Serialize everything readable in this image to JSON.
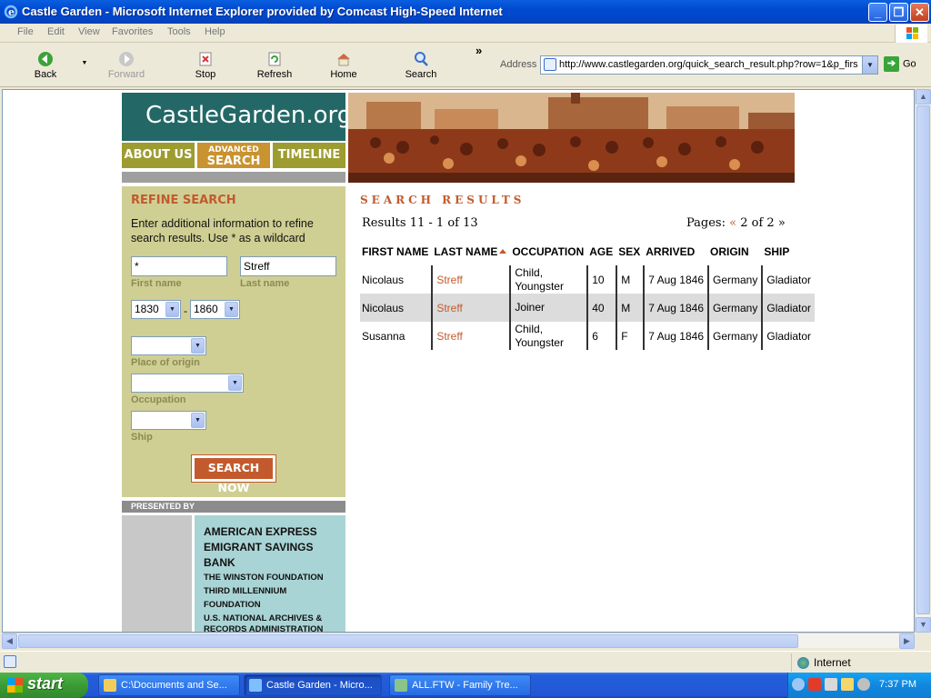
{
  "window": {
    "title": "Castle Garden - Microsoft Internet Explorer provided by Comcast High-Speed Internet"
  },
  "menu": [
    "File",
    "Edit",
    "View",
    "Favorites",
    "Tools",
    "Help"
  ],
  "toolbar": {
    "back": "Back",
    "forward": "Forward",
    "stop": "Stop",
    "refresh": "Refresh",
    "home": "Home",
    "search": "Search",
    "more": "»",
    "address_label": "Address",
    "url": "http://www.castlegarden.org/quick_search_result.php?row=1&p_firs",
    "go": "Go"
  },
  "site": {
    "logo": "CastleGarden.org",
    "nav": {
      "about": "ABOUT US",
      "advanced_top": "ADVANCED",
      "advanced_bottom": "SEARCH",
      "timeline": "TIMELINE"
    }
  },
  "refine": {
    "heading": "REFINE SEARCH",
    "description": "Enter additional information to refine search results. Use * as a wildcard",
    "first_name_value": "*",
    "first_name_label": "First name",
    "last_name_value": "Streff",
    "last_name_label": "Last name",
    "year_from": "1830",
    "year_to": "1860",
    "dash": "-",
    "origin_label": "Place of origin",
    "occupation_label": "Occupation",
    "ship_label": "Ship",
    "search_button": "SEARCH NOW"
  },
  "sponsors": {
    "heading": "PRESENTED BY",
    "items": [
      "AMERICAN EXPRESS",
      "EMIGRANT SAVINGS BANK",
      "THE WINSTON FOUNDATION",
      "THIRD MILLENNIUM FOUNDATION",
      "U.S. NATIONAL ARCHIVES & RECORDS ADMINISTRATION"
    ]
  },
  "results": {
    "title": "SEARCH RESULTS",
    "count": "Results 11 - 1 of 13",
    "pages_label": "Pages:",
    "prev": "«",
    "page_info": "2 of 2",
    "next": "»",
    "columns": [
      "FIRST NAME",
      "LAST NAME",
      "OCCUPATION",
      "AGE",
      "SEX",
      "ARRIVED",
      "ORIGIN",
      "SHIP"
    ],
    "rows": [
      [
        "Nicolaus",
        "Streff",
        "Child, Youngster",
        "10",
        "M",
        "7 Aug 1846",
        "Germany",
        "Gladiator"
      ],
      [
        "Nicolaus",
        "Streff",
        "Joiner",
        "40",
        "M",
        "7 Aug 1846",
        "Germany",
        "Gladiator"
      ],
      [
        "Susanna",
        "Streff",
        "Child, Youngster",
        "6",
        "F",
        "7 Aug 1846",
        "Germany",
        "Gladiator"
      ]
    ]
  },
  "status": {
    "zone": "Internet"
  },
  "taskbar": {
    "start": "start",
    "tasks": [
      "C:\\Documents and Se...",
      "Castle Garden - Micro...",
      "ALL.FTW - Family Tre..."
    ],
    "clock": "7:37 PM"
  },
  "colors": {
    "accent": "#c35a2d",
    "logo_bg": "#236866",
    "nav_olive": "#9d9c30",
    "nav_gold": "#c89330",
    "refine_bg": "#cfcf94",
    "sponsor_bg": "#a9d4d5"
  }
}
